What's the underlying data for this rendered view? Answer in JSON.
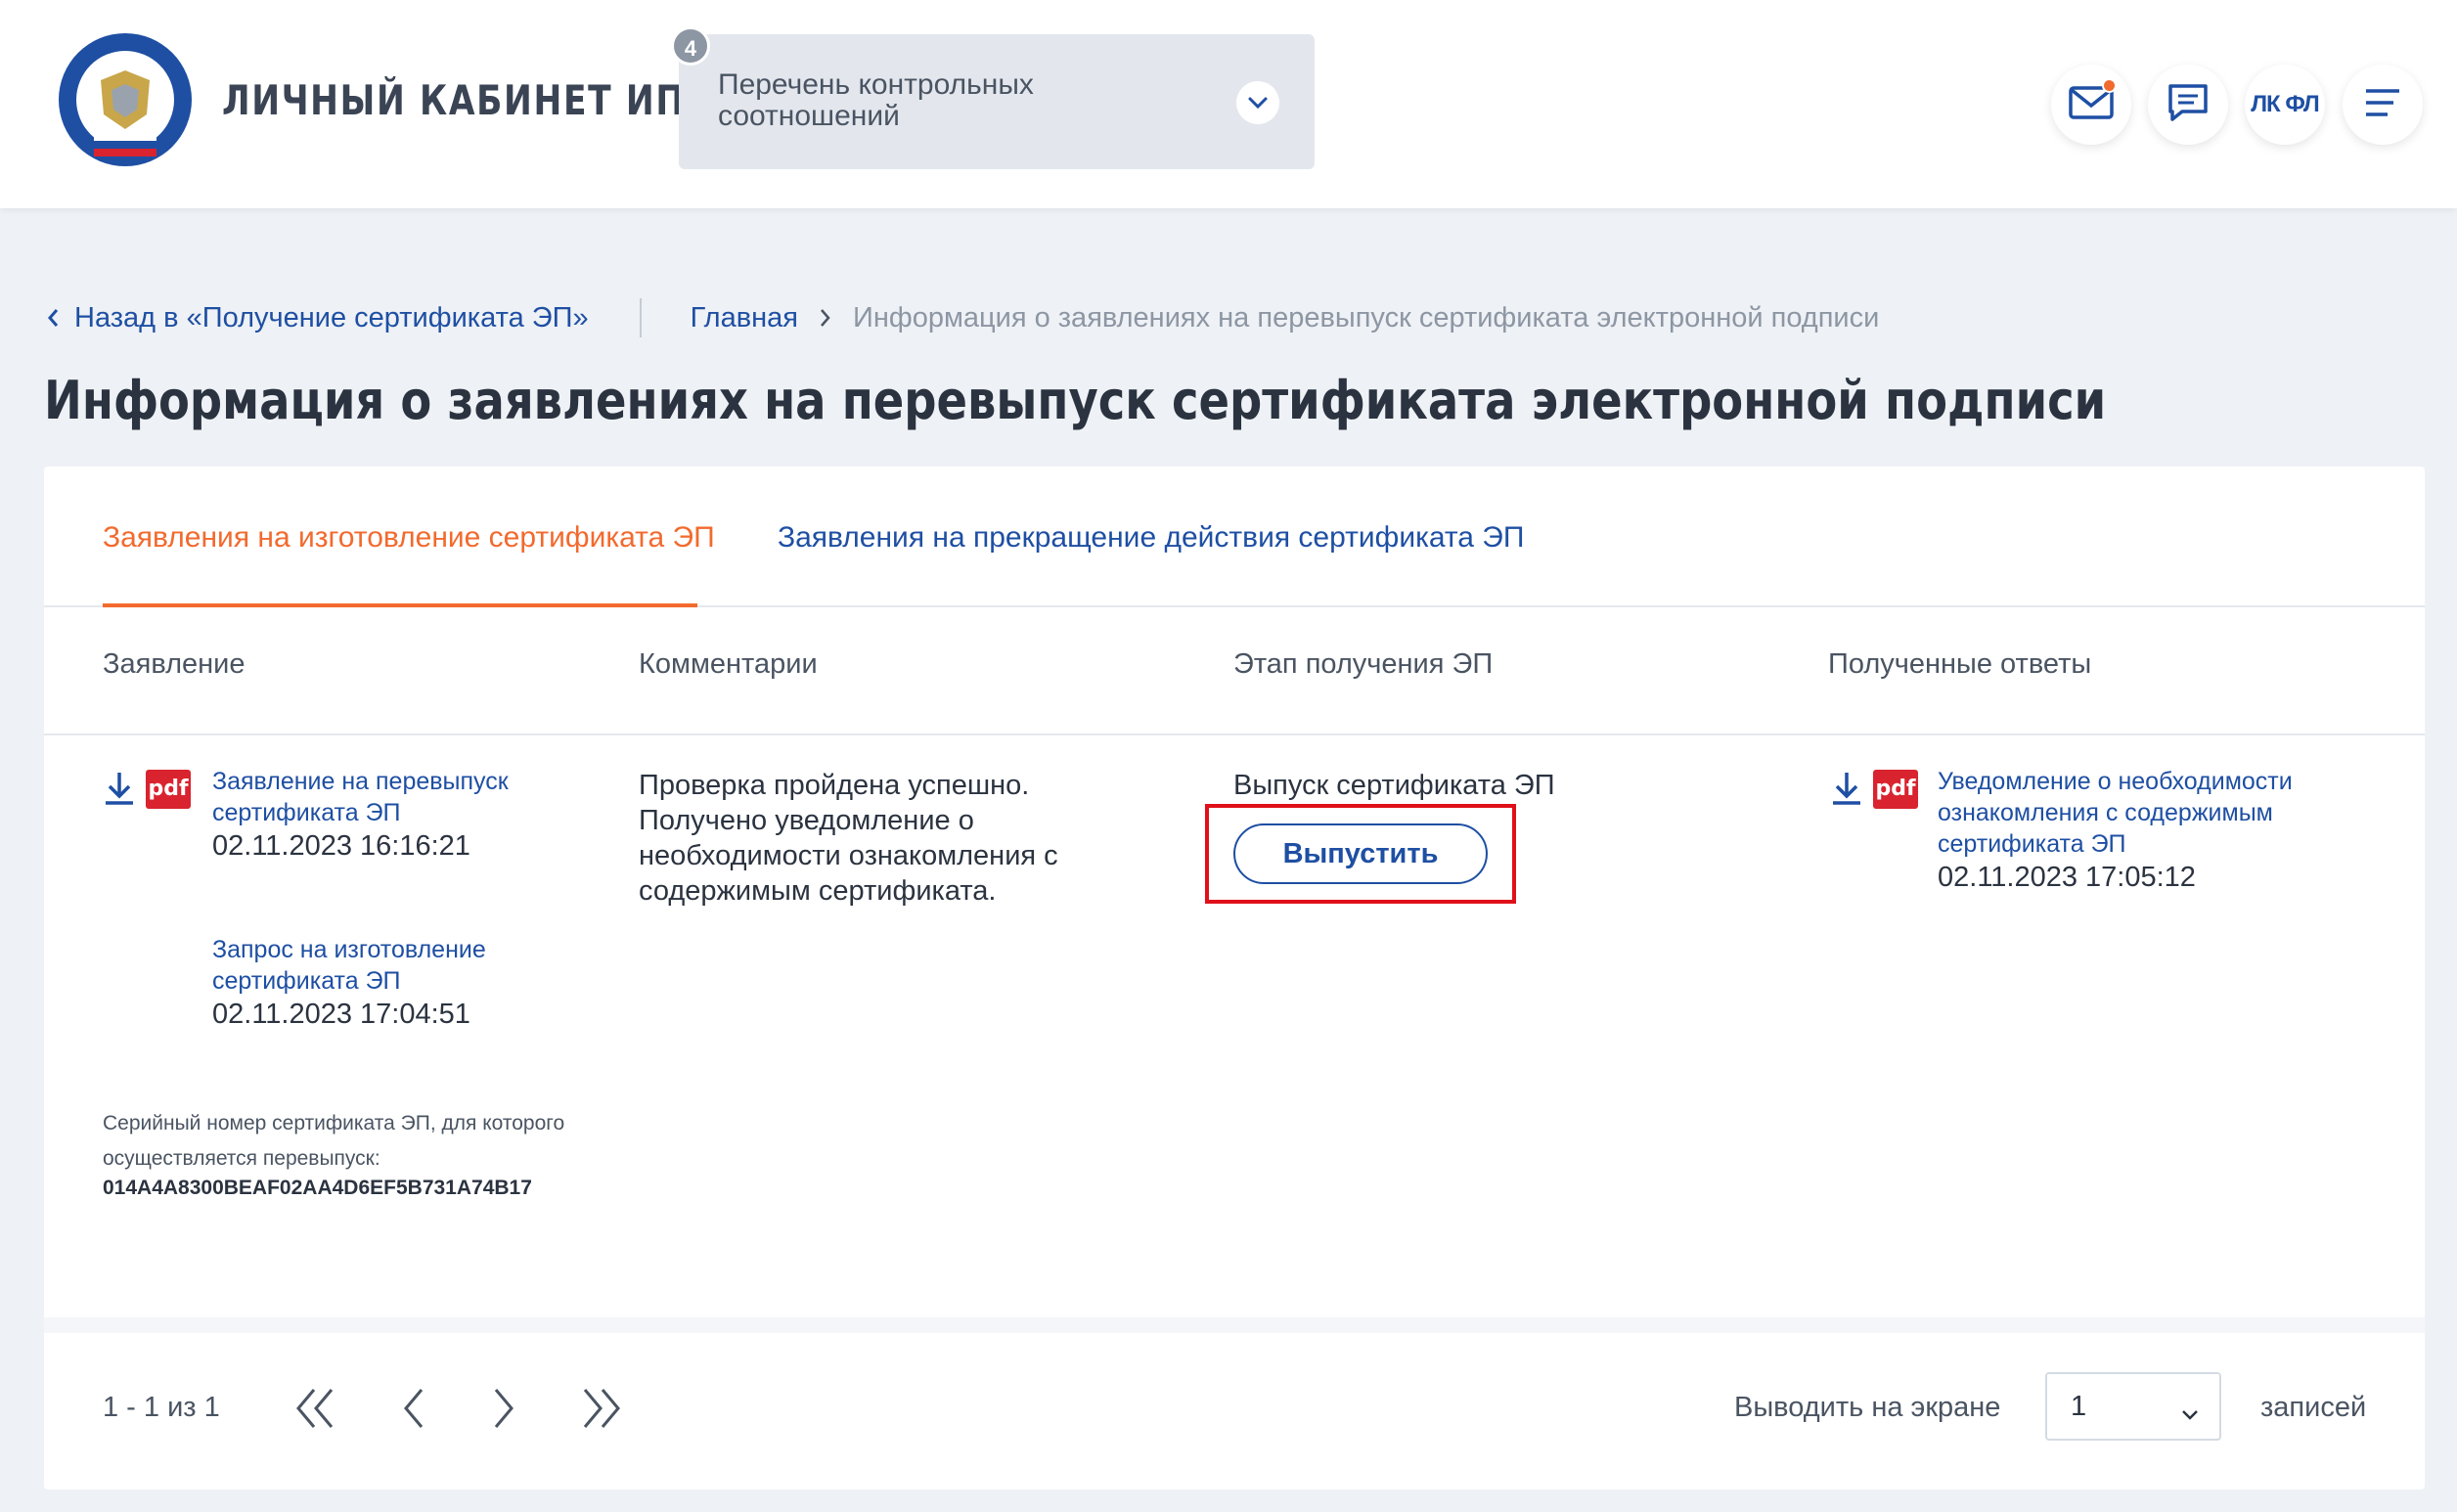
{
  "header": {
    "app_title": "ЛИЧНЫЙ КАБИНЕТ ИП",
    "logo_name": "ФНС emblem",
    "dropdown": {
      "badge": "4",
      "label": "Перечень контрольных соотношений"
    },
    "icons": {
      "mail": "mail-icon",
      "chat": "chat-icon",
      "lk_label": "ЛК ФЛ",
      "menu": "menu-icon"
    }
  },
  "breadcrumbs": {
    "back": "Назад в «Получение сертификата ЭП»",
    "home": "Главная",
    "current": "Информация о заявлениях на перевыпуск сертификата электронной подписи"
  },
  "page_title": "Информация о заявлениях на перевыпуск сертификата электронной подписи",
  "tabs": [
    {
      "label": "Заявления на изготовление сертификата ЭП",
      "active": true
    },
    {
      "label": "Заявления на прекращение действия сертификата ЭП",
      "active": false
    }
  ],
  "table": {
    "columns": [
      "Заявление",
      "Комментарии",
      "Этап получения ЭП",
      "Полученные ответы"
    ],
    "row": {
      "application": {
        "doc1_title": "Заявление на перевыпуск сертификата ЭП",
        "doc1_date": "02.11.2023 16:16:21",
        "doc2_title": "Запрос на изготовление сертификата ЭП",
        "doc2_date": "02.11.2023 17:04:51",
        "serial_label": "Серийный номер сертификата ЭП, для которого осуществляется перевыпуск:",
        "serial_value": "014A4A8300BEAF02AA4D6EF5B731A74B17",
        "pdf_label": "pdf"
      },
      "comment": "Проверка пройдена успешно. Получено уведомление о необходимости ознакомления с содержимым сертификата.",
      "stage": {
        "text": "Выпуск сертификата ЭП",
        "button": "Выпустить"
      },
      "response": {
        "title": "Уведомление о необходимости ознакомления с содержимым сертификата ЭП",
        "date": "02.11.2023 17:05:12",
        "pdf_label": "pdf"
      }
    }
  },
  "pagination": {
    "count": "1 - 1 из 1",
    "per_page_label": "Выводить на экране",
    "per_page_value": "1",
    "per_page_suffix": "записей"
  },
  "colors": {
    "accent": "#f26a2e",
    "link": "#1e4fa3",
    "highlight": "#e0101a",
    "pdf": "#d9232e"
  }
}
